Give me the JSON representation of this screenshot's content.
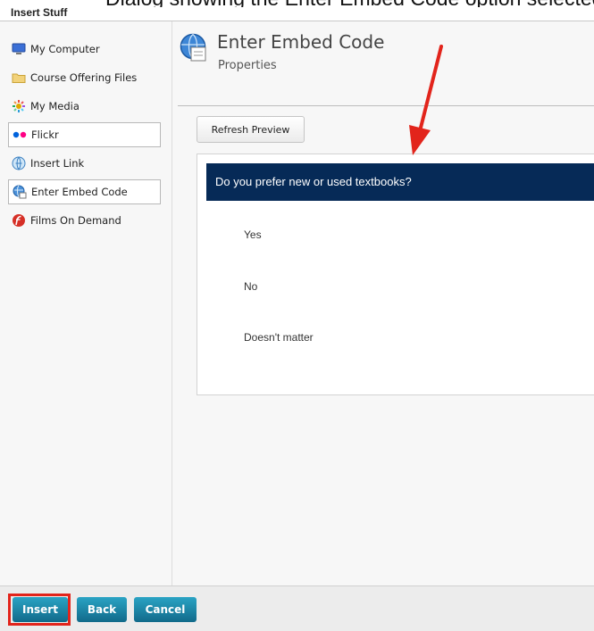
{
  "caption_fragment": "Dialog showing the Enter Embed Code option selected in Insert Stuff",
  "dialog": {
    "title": "Insert Stuff"
  },
  "sidebar": {
    "items": [
      {
        "label": "My Computer",
        "icon": "computer-icon"
      },
      {
        "label": "Course Offering Files",
        "icon": "folder-icon"
      },
      {
        "label": "My Media",
        "icon": "media-icon"
      },
      {
        "label": "Flickr",
        "icon": "flickr-icon"
      },
      {
        "label": "Insert Link",
        "icon": "link-icon"
      },
      {
        "label": "Enter Embed Code",
        "icon": "embed-icon"
      },
      {
        "label": "Films On Demand",
        "icon": "films-icon"
      }
    ],
    "selected": "Enter Embed Code"
  },
  "main": {
    "title": "Enter Embed Code",
    "subtitle": "Properties",
    "refresh_label": "Refresh Preview",
    "preview": {
      "question": "Do you prefer new or used textbooks?",
      "options": [
        "Yes",
        "No",
        "Doesn't matter"
      ]
    }
  },
  "footer": {
    "insert_label": "Insert",
    "back_label": "Back",
    "cancel_label": "Cancel"
  },
  "colors": {
    "question_bar": "#062a57",
    "button": "#1a86a8",
    "annotation": "#e2241b"
  }
}
